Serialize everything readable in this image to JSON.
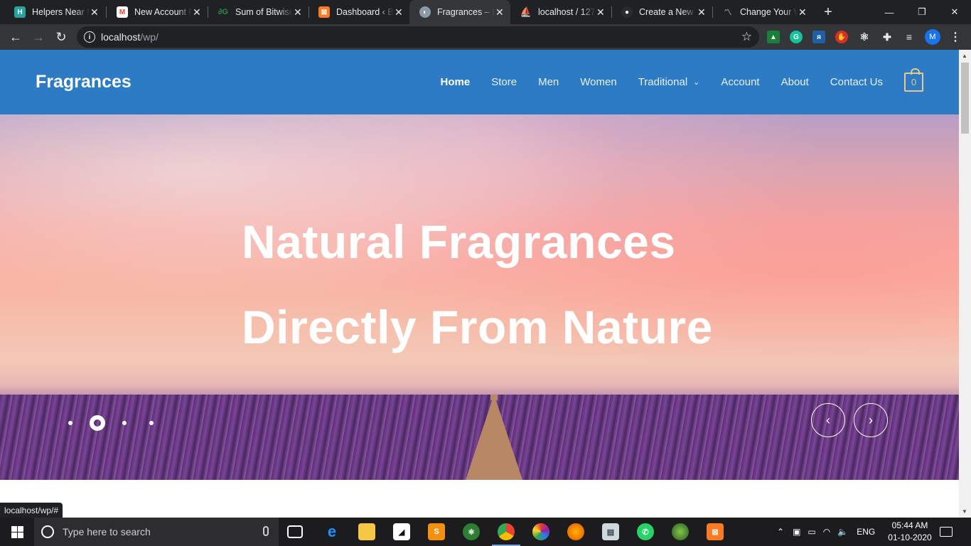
{
  "browser": {
    "tabs": [
      {
        "title": "Helpers Near M",
        "icon": "helpers-favicon",
        "color": "#2aa3a0",
        "active": false
      },
      {
        "title": "New Account R",
        "icon": "gmail-favicon",
        "color": "#ea4335",
        "active": false
      },
      {
        "title": "Sum of Bitwise",
        "icon": "gfg-favicon",
        "color": "#2f8d46",
        "active": false
      },
      {
        "title": "Dashboard ‹ Bo",
        "icon": "xampp-favicon",
        "color": "#fb7a24",
        "active": false
      },
      {
        "title": "Fragrances – Be",
        "icon": "site-favicon",
        "color": "#8a9aa8",
        "active": true
      },
      {
        "title": "localhost / 127",
        "icon": "phpmyadmin-favicon",
        "color": "#f29111",
        "active": false
      },
      {
        "title": "Create a New R",
        "icon": "github-favicon",
        "color": "#24292e",
        "active": false
      },
      {
        "title": "Change Your W",
        "icon": "wordpress-favicon",
        "color": "#9aa0a6",
        "active": false
      }
    ],
    "new_tab": "+",
    "window": {
      "minimize": "—",
      "maximize": "❐",
      "close": "✕"
    },
    "address": {
      "host": "localhost",
      "path": "/wp/"
    },
    "profile_initial": "M"
  },
  "site": {
    "brand": "Fragrances",
    "menu": [
      {
        "label": "Home",
        "current": true
      },
      {
        "label": "Store"
      },
      {
        "label": "Men"
      },
      {
        "label": "Women"
      },
      {
        "label": "Traditional",
        "dropdown": true
      },
      {
        "label": "Account"
      },
      {
        "label": "About"
      },
      {
        "label": "Contact Us"
      }
    ],
    "cart_count": "0",
    "hero": {
      "line1": "Natural Fragrances",
      "line2": "Directly From Nature",
      "slides": 4,
      "active_slide": 2
    }
  },
  "status_url": "localhost/wp/#",
  "taskbar": {
    "search_placeholder": "Type here to search",
    "language": "ENG",
    "time": "05:44 AM",
    "date": "01-10-2020"
  }
}
